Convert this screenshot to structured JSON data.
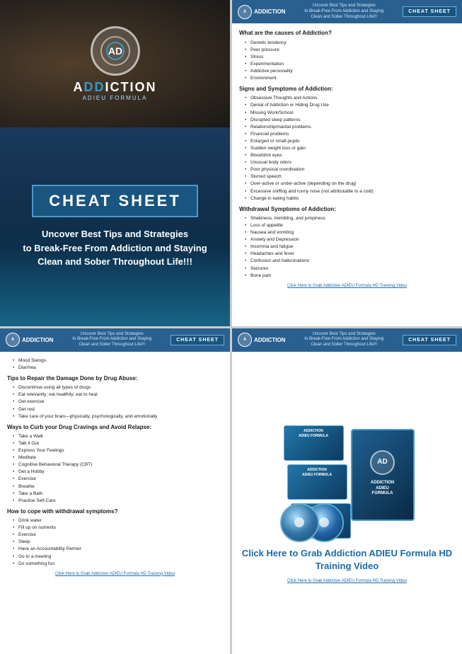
{
  "colors": {
    "brand_blue": "#1a5580",
    "header_bg": "#2a6090",
    "link_color": "#1a6aaa"
  },
  "panel1": {
    "logo_letters": "ADDICTION",
    "logo_dd": "DD",
    "brand_name": "ADDICTION",
    "brand_sub": "ADIEU FORMULA",
    "cheat_sheet_label": "CHEAT SHEET",
    "tagline_line1": "Uncover Best Tips and Strategies",
    "tagline_line2": "to Break-Free From Addiction and Staying",
    "tagline_line3": "Clean and Sober Throughout Life!!!"
  },
  "panel_header": {
    "logo_abbr": "A",
    "logo_text": "ADDICTION",
    "tagline": "Uncover Best Tips and Strategies\nto Break-Free From Addiction and Staying\nClean and Sober Throughout Life!!!",
    "badge": "CHEAT SHEET"
  },
  "panel2": {
    "section1_title": "What are the causes of Addiction?",
    "section1_items": [
      "Genetic tendency",
      "Peer pressure",
      "Stress",
      "Experimentation",
      "Addictive personality",
      "Environment"
    ],
    "section2_title": "Signs and Symptoms of Addiction:",
    "section2_items": [
      "Obsessive Thoughts and Actions",
      "Denial of Addiction or Hiding Drug Use",
      "Missing Work/School",
      "Disrupted sleep patterns",
      "Relationship/marital problems",
      "Financial problems",
      "Enlarged or small pupils",
      "Sudden weight loss or gain",
      "Bloodshot eyes",
      "Unusual body odors",
      "Poor physical coordination",
      "Slurred speech",
      "Over-active or under-active (depending on the drug)",
      "Excessive sniffing and runny nose (not attributable to a cold)",
      "Change in eating habits"
    ],
    "section3_title": "Withdrawal Symptoms of Addiction:",
    "section3_items": [
      "Shakiness, trembling, and jumpiness",
      "Loss of appetite",
      "Nausea and vomiting",
      "Anxiety and Depression",
      "Insomnia and fatigue",
      "Headaches and fever",
      "Confusion and hallucinations",
      "Seizures",
      "Bone pain"
    ],
    "click_link": "Click Here to Grab Addiction ADIEU Formula HD Training Video"
  },
  "panel3": {
    "intro_items": [
      "Mood Swings",
      "Diarrhea"
    ],
    "section1_title": "Tips to Repair the Damage Done by Drug Abuse:",
    "section1_items": [
      "Discontinue using all types of drugs",
      "Eat relevantly; eat healthily; eat to heal",
      "Get exercise",
      "Get rest",
      "Take care of your brain—physically, psychologically, and emotionally"
    ],
    "section2_title": "Ways to Curb your Drug Cravings and Avoid Relapse:",
    "section2_items": [
      "Take a Walk",
      "Talk it Out",
      "Express Your Feelings",
      "Meditate",
      "Cognitive Behavioral Therapy (CBT)",
      "Get a Hobby",
      "Exercise",
      "Breathe",
      "Take a Bath",
      "Practice Self-Care"
    ],
    "section3_title": "How to cope with withdrawal symptoms?",
    "section3_items": [
      "Drink water",
      "Fill up on nutrients",
      "Exercise",
      "Sleep",
      "Have an Accountability Partner",
      "Go to a meeting",
      "Do something fun"
    ],
    "click_link": "Click Here to Grab Addiction ADIEU Formula HD Training Video"
  },
  "panel4": {
    "cta": "Click Here to Grab Addiction ADIEU Formula HD Training Video",
    "click_link": "Click Here to Grab Addiction ADIEU Formula HD Training Video"
  }
}
